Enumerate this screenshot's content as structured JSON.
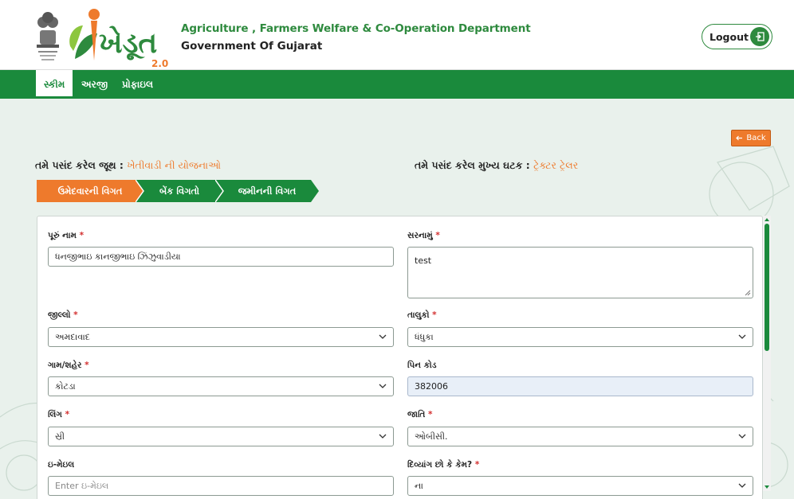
{
  "header": {
    "logo_text": "ખેડૂત",
    "logo_version": "2.0",
    "department": "Agriculture , Farmers Welfare & Co-Operation Department",
    "government": "Government Of Gujarat",
    "logout_label": "Logout"
  },
  "nav": {
    "items": [
      {
        "label": "સ્કીમ",
        "active": true
      },
      {
        "label": "અરજી",
        "active": false
      },
      {
        "label": "પ્રોફાઇલ",
        "active": false
      }
    ]
  },
  "back_label": "Back",
  "selection": {
    "group_label": "તમે પસંદ કરેલ જૂથ :",
    "group_value": "ખેતીવાડી ની યોજનાઓ",
    "component_label": "તમે પસંદ કરેલ મુખ્ય ઘટક :",
    "component_value": "ટ્રેક્ટર ટ્રેલર"
  },
  "steps": [
    {
      "label": "ઉમેદવારની વિગત",
      "active": true
    },
    {
      "label": "બેંક વિગતો",
      "active": false
    },
    {
      "label": "જમીનની વિગત",
      "active": false
    }
  ],
  "form": {
    "full_name": {
      "label": "પૂરું નામ",
      "required": "*",
      "value": "ધનજીભાઇ કાનજીભાઇ ઝિંઝુવાડીયા"
    },
    "address": {
      "label": "સરનામું",
      "required": "*",
      "value": "test"
    },
    "district": {
      "label": "જીલ્લો",
      "required": "*",
      "value": "અમદાવાદ"
    },
    "taluka": {
      "label": "તાલુકો",
      "required": "*",
      "value": "ધંધુકા"
    },
    "village": {
      "label": "ગામ/શહેર",
      "required": "*",
      "value": "કોટડા"
    },
    "pincode": {
      "label": "પિન કોડ",
      "value": "382006"
    },
    "gender": {
      "label": "લિંગ",
      "required": "*",
      "value": "સ્રી"
    },
    "caste": {
      "label": "જાતિ",
      "required": "*",
      "value": "ઓબીસી."
    },
    "email": {
      "label": "ઇ-મેઇલ",
      "placeholder": "Enter ઇ-મેઇલ"
    },
    "disabled": {
      "label": "દિવ્યાંગ છો કે કેમ?",
      "required": "*",
      "value": "ના"
    }
  },
  "colors": {
    "primary_green": "#1a8a3c",
    "accent_orange": "#ee7a2c",
    "background": "#e9f1ec"
  }
}
